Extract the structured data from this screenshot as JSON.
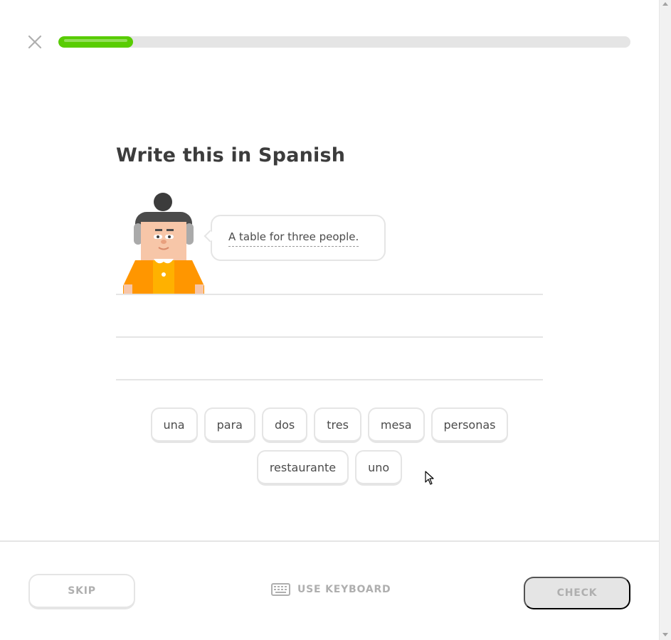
{
  "header": {
    "close_icon": "close-icon",
    "progress": 0.13,
    "progress_color": "#58cc02"
  },
  "challenge": {
    "title": "Write this in Spanish",
    "sentence": "A table for three people."
  },
  "word_bank": {
    "rows": [
      [
        "una",
        "para",
        "dos",
        "tres",
        "mesa",
        "personas"
      ],
      [
        "restaurante",
        "uno"
      ]
    ]
  },
  "footer": {
    "skip_label": "SKIP",
    "keyboard_label": "USE KEYBOARD",
    "check_label": "CHECK"
  },
  "colors": {
    "border": "#e5e5e5",
    "text": "#3c3c3c",
    "muted": "#afafaf",
    "accent": "#58cc02"
  }
}
